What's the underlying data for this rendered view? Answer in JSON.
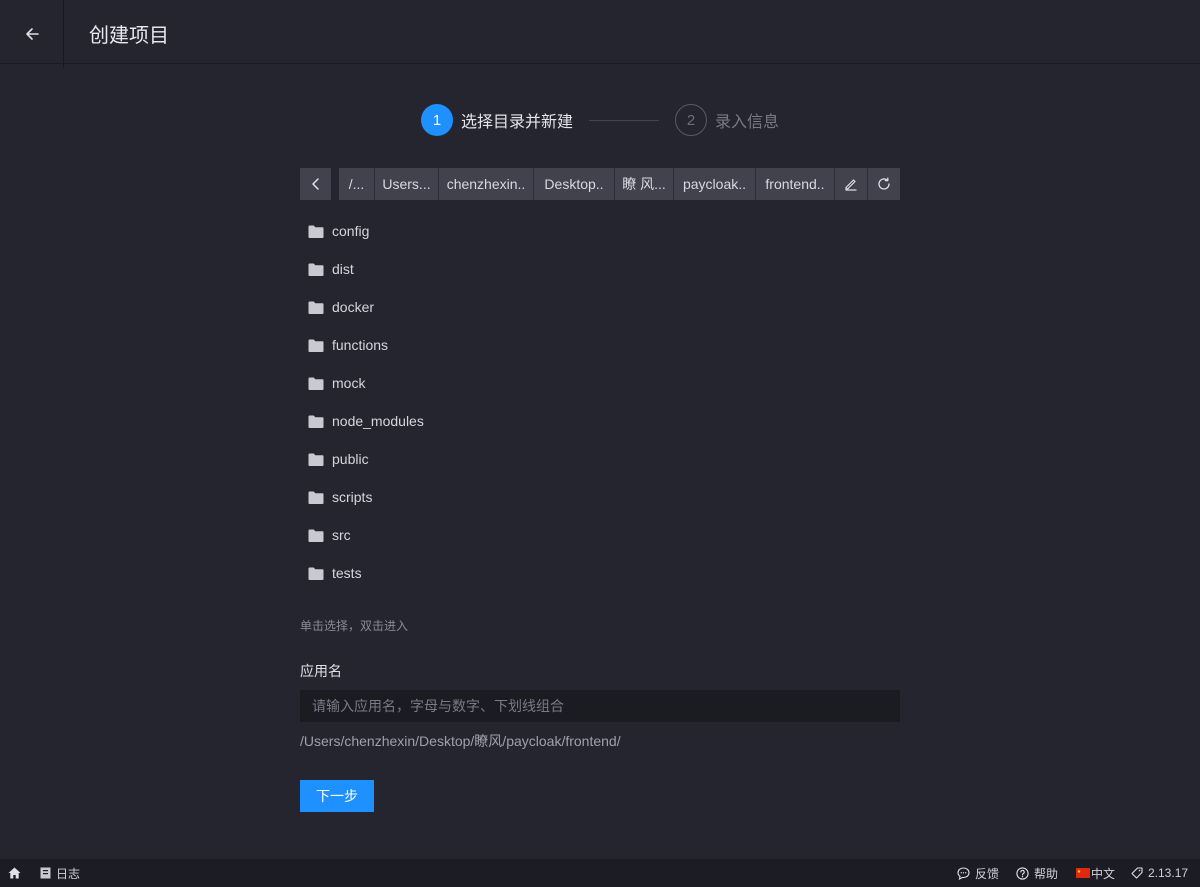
{
  "header": {
    "title": "创建项目",
    "back_icon": "arrow-left-icon"
  },
  "steps": [
    {
      "number": "1",
      "label": "选择目录并新建",
      "state": "active"
    },
    {
      "number": "2",
      "label": "录入信息",
      "state": "inactive"
    }
  ],
  "breadcrumb": {
    "items": [
      "/...",
      "Users...",
      "chenzhexin..",
      "Desktop..",
      "瞭 风...",
      "paycloak..",
      "frontend.."
    ],
    "tools": [
      "edit-icon",
      "refresh-icon"
    ]
  },
  "folders": [
    "config",
    "dist",
    "docker",
    "functions",
    "mock",
    "node_modules",
    "public",
    "scripts",
    "src",
    "tests"
  ],
  "hint": "单击选择，双击进入",
  "form": {
    "app_name_label": "应用名",
    "app_name_placeholder": "请输入应用名，字母与数字、下划线组合",
    "app_name_value": "",
    "full_path": "/Users/chenzhexin/Desktop/瞭风/paycloak/frontend/",
    "next_label": "下一步"
  },
  "statusbar": {
    "home_icon": "home-icon",
    "log_label": "日志",
    "feedback_label": "反馈",
    "help_label": "帮助",
    "language_label": "中文",
    "version": "2.13.17"
  },
  "colors": {
    "accent": "#1e90ff",
    "background": "#252530",
    "panel": "#42424f",
    "statusbar": "#1c1c24"
  }
}
